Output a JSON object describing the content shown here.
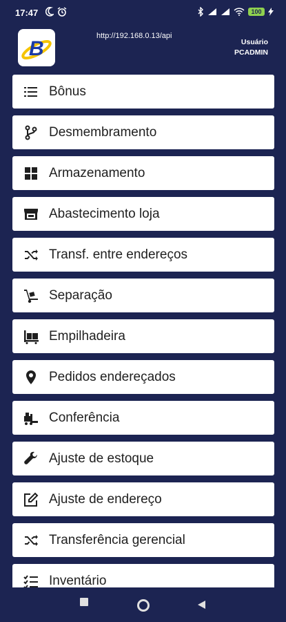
{
  "status_bar": {
    "time": "17:47",
    "battery_level": "100",
    "icons": [
      "moon-icon",
      "alarm-icon",
      "bluetooth-icon",
      "signal-icon",
      "signal-icon",
      "wifi-icon",
      "battery-icon",
      "charging-icon"
    ]
  },
  "header": {
    "url": "http://192.168.0.13/api",
    "user_label": "Usuário",
    "user_name": "PCADMIN"
  },
  "menu": {
    "items": [
      {
        "label": "Bônus",
        "icon": "list-icon"
      },
      {
        "label": "Desmembramento",
        "icon": "fork-icon"
      },
      {
        "label": "Armazenamento",
        "icon": "grid-icon"
      },
      {
        "label": "Abastecimento loja",
        "icon": "store-icon"
      },
      {
        "label": "Transf. entre endereços",
        "icon": "shuffle-icon"
      },
      {
        "label": "Separação",
        "icon": "dolly-icon"
      },
      {
        "label": "Empilhadeira",
        "icon": "pallet-icon"
      },
      {
        "label": "Pedidos endereçados",
        "icon": "location-pin-icon"
      },
      {
        "label": "Conferência",
        "icon": "forklift-icon"
      },
      {
        "label": "Ajuste de estoque",
        "icon": "wrench-icon"
      },
      {
        "label": "Ajuste de endereço",
        "icon": "edit-icon"
      },
      {
        "label": "Transferência gerencial",
        "icon": "shuffle-icon"
      },
      {
        "label": "Inventário",
        "icon": "checklist-icon"
      }
    ]
  },
  "nav_bar": {
    "buttons": [
      "recent-apps-icon",
      "home-icon",
      "back-icon"
    ]
  },
  "colors": {
    "background": "#1c2452",
    "card": "#ffffff",
    "text": "#1f1f1f",
    "logo_blue": "#1a3aa6",
    "logo_yellow": "#f5c400"
  }
}
